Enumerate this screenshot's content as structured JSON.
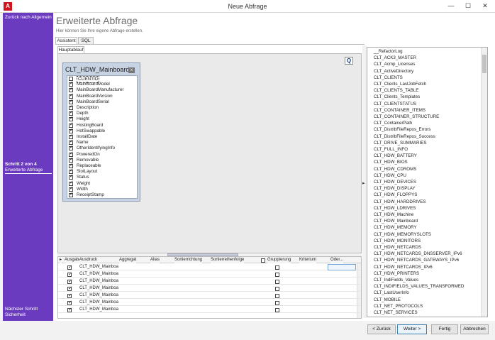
{
  "window": {
    "title": "Neue Abfrage",
    "app_icon_letter": "A",
    "btn_min": "—",
    "btn_max": "☐",
    "btn_close": "✕"
  },
  "sidebar": {
    "back": "Zurück nach Allgemein",
    "step_title": "Schritt 2 von 4",
    "step_name": "Erweiterte Abfrage",
    "next_label": "Nächster Schritt",
    "next_name": "Sicherheit",
    "color": "#6b3bbf"
  },
  "header": {
    "title": "Erweiterte Abfrage",
    "subtitle": "Hier können Sie Ihre eigene Abfrage erstellen."
  },
  "tabs": [
    "Assistent",
    "SQL"
  ],
  "subtab": "Hauptablauf",
  "query_button": "Q",
  "table": {
    "name": "CLT_HDW_Mainboard",
    "close_icon": "x",
    "columns": [
      {
        "name": "CLIENTID",
        "checked": false
      },
      {
        "name": "MainBoardModel",
        "checked": true
      },
      {
        "name": "MainBoardManufacturer",
        "checked": true
      },
      {
        "name": "MainBoardVersion",
        "checked": true
      },
      {
        "name": "MainBoardSerial",
        "checked": true
      },
      {
        "name": "Description",
        "checked": true
      },
      {
        "name": "Depth",
        "checked": true
      },
      {
        "name": "Height",
        "checked": true
      },
      {
        "name": "HostingBoard",
        "checked": true
      },
      {
        "name": "HotSwappable",
        "checked": true
      },
      {
        "name": "InstallDate",
        "checked": true
      },
      {
        "name": "Name",
        "checked": true
      },
      {
        "name": "OtherIdentifyingInfo",
        "checked": true
      },
      {
        "name": "PoweredOn",
        "checked": true
      },
      {
        "name": "Removable",
        "checked": true
      },
      {
        "name": "Replaceable",
        "checked": true
      },
      {
        "name": "SlotLayout",
        "checked": true
      },
      {
        "name": "Status",
        "checked": true
      },
      {
        "name": "Weight",
        "checked": true
      },
      {
        "name": "Width",
        "checked": true
      },
      {
        "name": "ReceiptStamp",
        "checked": true
      }
    ]
  },
  "grid": {
    "headers": [
      "Ausgabe",
      "Ausdruck",
      "Aggregat",
      "Alias",
      "Sortierrichtung",
      "Sortierreihenfolge",
      "Gruppierung",
      "Kriterium",
      "Oder..."
    ],
    "rows": [
      {
        "expr": "CLT_HDW_Mainboard"
      },
      {
        "expr": "CLT_HDW_Mainboard"
      },
      {
        "expr": "CLT_HDW_Mainboard"
      },
      {
        "expr": "CLT_HDW_Mainboard"
      },
      {
        "expr": "CLT_HDW_Mainboard"
      },
      {
        "expr": "CLT_HDW_Mainboard"
      },
      {
        "expr": "CLT_HDW_Mainboard"
      }
    ]
  },
  "tables_list": [
    "__RefactorLog",
    "CLT_ACK3_MASTER",
    "CLT_Acmp_Licenses",
    "CLT_ActiveDirectory",
    "CLT_CLIENTS",
    "CLT_Clients_LastJobFetch",
    "CLT_CLIENTS_TABLE",
    "CLT_Clients_Templates",
    "CLT_CLIENTSTATUS",
    "CLT_CONTAINER_ITEMS",
    "CLT_CONTAINER_STRUCTURE",
    "CLT_ContainerPath",
    "CLT_DistribFileRepos_Errors",
    "CLT_DistribFileRepos_Success",
    "CLT_DRIVE_SUMMARIES",
    "CLT_FULL_INFO",
    "CLT_HDW_BATTERY",
    "CLT_HDW_BIOS",
    "CLT_HDW_CDROMS",
    "CLT_HDW_CPU",
    "CLT_HDW_DEVICES",
    "CLT_HDW_DISPLAY",
    "CLT_HDW_FLOPPYS",
    "CLT_HDW_HARDDRIVES",
    "CLT_HDW_LDRIVES",
    "CLT_HDW_Machine",
    "CLT_HDW_Mainboard",
    "CLT_HDW_MEMORY",
    "CLT_HDW_MEMORYSLOTS",
    "CLT_HDW_MONITORS",
    "CLT_HDW_NETCARDS",
    "CLT_HDW_NETCARDS_DNSSERVER_IPv6",
    "CLT_HDW_NETCARDS_GATEWAYS_IPv6",
    "CLT_HDW_NETCARDS_IPv6",
    "CLT_HDW_PRINTERS",
    "CLT_IndiFields_Values",
    "CLT_INDIFIELDS_VALUES_TRANSFORMED",
    "CLT_LastUserInfo",
    "CLT_MOBILE",
    "CLT_NET_PROTOCOLS",
    "CLT_NET_SERVICES"
  ],
  "footer": {
    "back": "< Zurück",
    "next": "Weiter >",
    "finish": "Fertig",
    "cancel": "Abbrechen"
  }
}
